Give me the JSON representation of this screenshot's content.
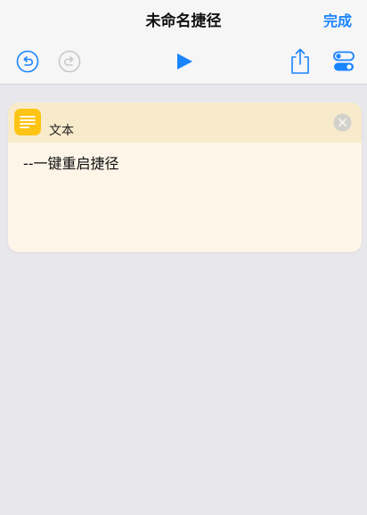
{
  "nav": {
    "title": "未命名捷径",
    "done_label": "完成"
  },
  "toolbar": {
    "undo_icon": "undo-icon",
    "redo_icon": "redo-icon",
    "play_icon": "play-icon",
    "share_icon": "share-icon",
    "settings_icon": "toggles-icon"
  },
  "action": {
    "label": "文本",
    "icon": "text-lines-icon",
    "text": "--一键重启捷径"
  },
  "colors": {
    "accent": "#1a84ff",
    "icon_yellow": "#fdc413",
    "card_header": "#f8ebcb",
    "card_body": "#fdf5e7",
    "background": "#e7e7ec"
  }
}
